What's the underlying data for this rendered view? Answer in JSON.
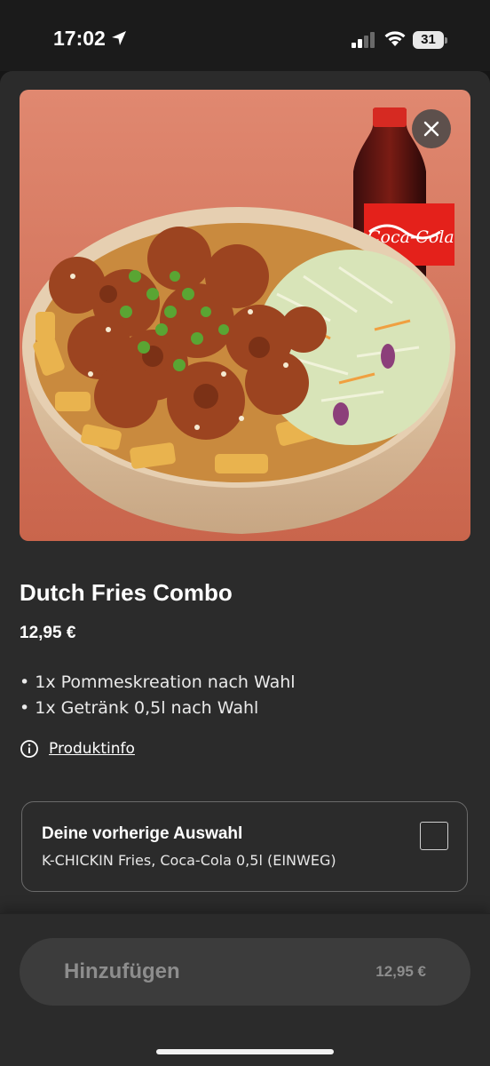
{
  "status_bar": {
    "time": "17:02",
    "battery": "31"
  },
  "product": {
    "image_alt": "Dutch Fries Combo",
    "title": "Dutch Fries Combo",
    "price": "12,95 €",
    "description": [
      "• 1x Pommeskreation nach Wahl",
      "• 1x Getränk 0,5l nach Wahl"
    ],
    "info_link": "Produktinfo"
  },
  "previous_selection": {
    "title": "Deine vorherige Auswahl",
    "subtitle": "K-CHICKIN Fries, Coca-Cola 0,5l (EINWEG)",
    "checked": false
  },
  "cta": {
    "label": "Hinzufügen",
    "price": "12,95 €"
  },
  "icons": {
    "location": "location-arrow-icon",
    "signal": "cellular-signal-icon",
    "wifi": "wifi-icon",
    "close": "close-icon",
    "info": "info-circle-icon"
  },
  "colors": {
    "background": "#2b2b2b",
    "button": "#3c3c3c",
    "button_text": "#8d8d8d",
    "hero_backdrop": "#d9775f"
  }
}
